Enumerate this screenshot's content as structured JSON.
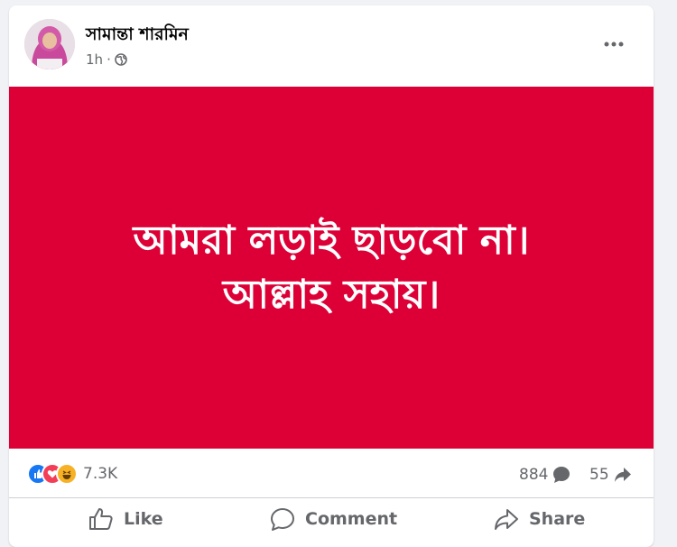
{
  "post": {
    "author": "সামান্তা শারমিন",
    "time": "1h",
    "separator": "·",
    "privacy_icon": "globe-icon",
    "more_icon": "more-horizontal-icon"
  },
  "image": {
    "background": "#dc0037",
    "lines": [
      "আমরা লড়াই ছাড়বো না।",
      "আল্লাহ সহায়।"
    ]
  },
  "stats": {
    "reactions": [
      "like-reaction-icon",
      "love-reaction-icon",
      "haha-reaction-icon"
    ],
    "reaction_count": "7.3K",
    "comment_count": "884",
    "share_count": "55"
  },
  "actions": {
    "like": "Like",
    "comment": "Comment",
    "share": "Share"
  },
  "colors": {
    "like_blue": "#1877f2",
    "love_red": "#f33e58",
    "haha_yellow": "#f7b125",
    "muted_text": "#65676b"
  }
}
